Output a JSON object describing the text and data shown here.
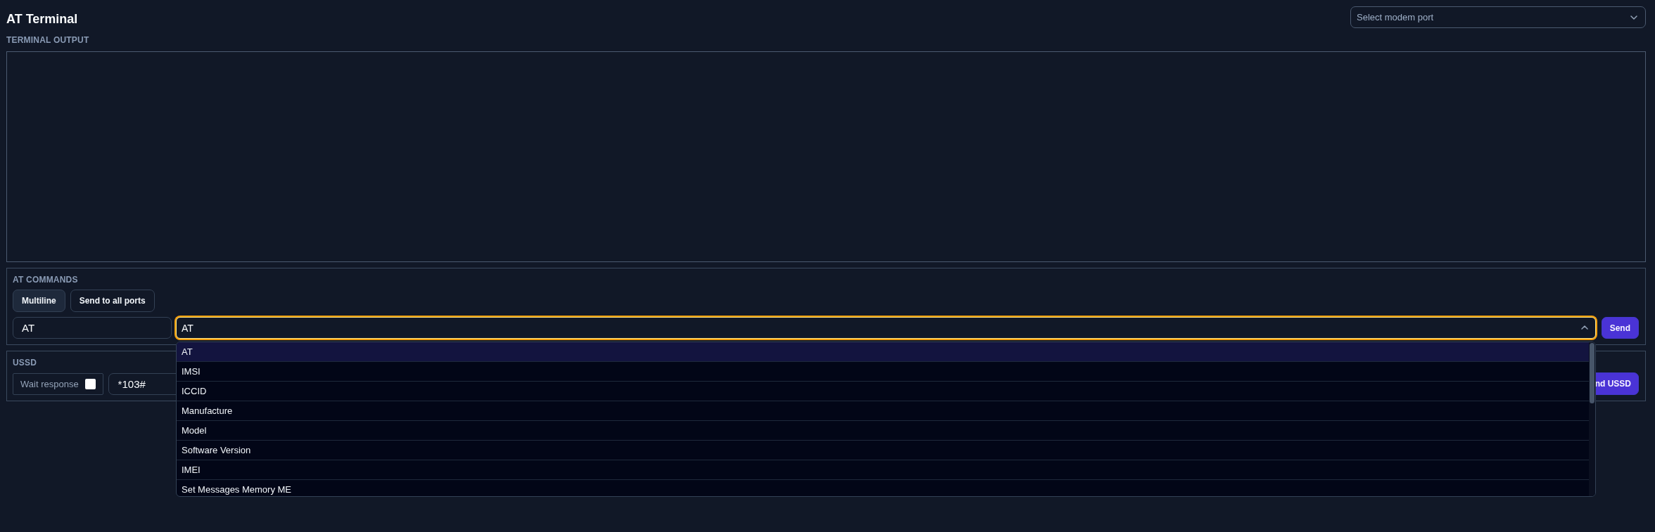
{
  "header": {
    "title": "AT Terminal",
    "port_select": {
      "placeholder": "Select modem port",
      "expanded": false
    }
  },
  "terminal_output": {
    "label": "TERMINAL OUTPUT"
  },
  "at_commands": {
    "label": "AT COMMANDS",
    "toggles": [
      {
        "label": "Multiline",
        "pressed": true
      },
      {
        "label": "Send to all ports",
        "pressed": false
      }
    ],
    "command_input": {
      "value": "AT"
    },
    "command_select": {
      "value": "AT",
      "expanded": true,
      "focused": true,
      "options": [
        {
          "label": "AT",
          "selected": true
        },
        {
          "label": "IMSI",
          "selected": false
        },
        {
          "label": "ICCID",
          "selected": false
        },
        {
          "label": "Manufacture",
          "selected": false
        },
        {
          "label": "Model",
          "selected": false
        },
        {
          "label": "Software Version",
          "selected": false
        },
        {
          "label": "IMEI",
          "selected": false
        },
        {
          "label": "Set Messages Memory ME",
          "selected": false
        }
      ]
    },
    "send_button": "Send"
  },
  "ussd": {
    "label": "USSD",
    "wait_response": {
      "label": "Wait response",
      "checked": false
    },
    "code_input": {
      "value": "*103#"
    },
    "send_button": "nd USSD"
  }
}
